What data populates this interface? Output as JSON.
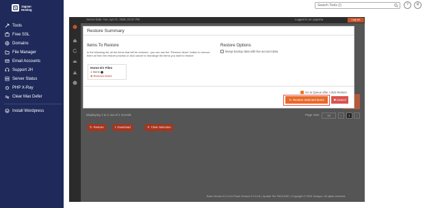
{
  "sidebar": {
    "logo_text_1": "Jagoan",
    "logo_text_2": "Hosting",
    "items": [
      {
        "label": "Tools",
        "icon": "tools-icon"
      },
      {
        "label": "Free SSL",
        "icon": "ssl-icon"
      },
      {
        "label": "Domains",
        "icon": "globe-icon"
      },
      {
        "label": "File Manager",
        "icon": "folder-icon"
      },
      {
        "label": "Email Accounts",
        "icon": "email-icon"
      },
      {
        "label": "Support JH",
        "icon": "support-icon"
      },
      {
        "label": "Server Status",
        "icon": "server-icon"
      },
      {
        "label": "PHP X-Ray",
        "icon": "bug-icon"
      },
      {
        "label": "Clear Max Defer",
        "icon": "wave-icon"
      }
    ],
    "extra": {
      "label": "Install Wordpress",
      "icon": "wordpress-icon"
    }
  },
  "topbar": {
    "search_placeholder": "Search Tools (/)",
    "help": "?",
    "user": "R"
  },
  "cpanel": {
    "server_date": "Server Date: Tue, Apr 07, 2026, 03:37 PM",
    "logged_in": "Logged in as: jagoana",
    "logout": "Log out",
    "displaying": "Displaying 1 to 1 out of 1 records",
    "page_size_label": "Page Size",
    "page_size_value": "10",
    "page_current": "1",
    "buttons": [
      "Restore",
      "Download",
      "Clear Selection"
    ],
    "version": "Base Version 5.3.14.6 Panel Version 5.3.14.6 | Update Tier RELEASE | Copyright © 2025 JetApps. All rights reserved."
  },
  "modal": {
    "title": "Restore Summary",
    "items_heading": "Items To Restore",
    "items_desc": "In the following list, all the items that will be restored - you can use the \"Remove Items\" button to remove them all from the restore process or click cancel to rearrange the items you want to restore",
    "options_heading": "Restore Options",
    "merge_label": "Merge backup data with live account data",
    "card_title": "Home Dir Files",
    "card_count": "1 Items",
    "card_remove": "Remove Items",
    "queue_label": "Go to Queue after I click Restore",
    "restore_button": "Restore Selected Items",
    "cancel_button": "Cancel"
  }
}
